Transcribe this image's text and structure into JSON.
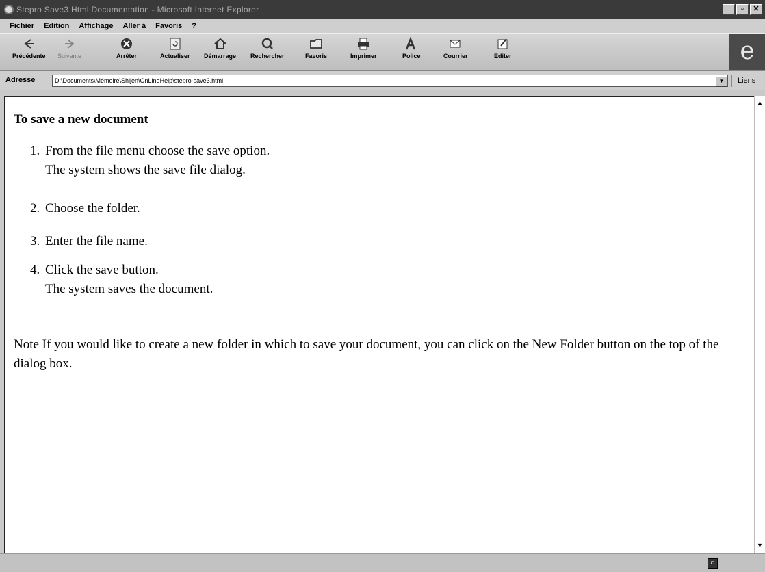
{
  "window": {
    "title": "Stepro Save3 Html Documentation - Microsoft Internet Explorer",
    "controls": [
      "_",
      "▫",
      "✕"
    ]
  },
  "menu": [
    "Fichier",
    "Edition",
    "Affichage",
    "Aller à",
    "Favoris",
    "?"
  ],
  "toolbar": {
    "back": "Précédente",
    "forward": "Suivante",
    "stop": "Arrêter",
    "refresh": "Actualiser",
    "home": "Démarrage",
    "search": "Rechercher",
    "favorites": "Favoris",
    "print": "Imprimer",
    "font": "Police",
    "mail": "Courrier",
    "edit": "Editer"
  },
  "address": {
    "label": "Adresse",
    "value": "D:\\Documents\\Mémoire\\Shijen\\OnLineHelp\\stepro-save3.html",
    "links": "Liens"
  },
  "document": {
    "title": "To save a new document",
    "steps": [
      {
        "num": "1.",
        "text": "From the file menu choose the save option.",
        "sub": "The system shows the save file dialog."
      },
      {
        "num": "2.",
        "text": "Choose the folder.",
        "sub": ""
      },
      {
        "num": "3.",
        "text": "Enter the file name.",
        "sub": ""
      },
      {
        "num": "4.",
        "text": "Click the save button.",
        "sub": "The system saves the document."
      }
    ],
    "note": "Note If you would like to create a new folder in which to save your document, you can click on the New Folder button on the top of the dialog box."
  },
  "icons": {
    "back": "arrow-left-icon",
    "forward": "arrow-right-icon",
    "stop": "stop-icon",
    "refresh": "refresh-icon",
    "home": "home-icon",
    "search": "search-icon",
    "favorites": "folder-icon",
    "print": "printer-icon",
    "font": "font-icon",
    "mail": "mail-icon",
    "edit": "edit-icon"
  }
}
